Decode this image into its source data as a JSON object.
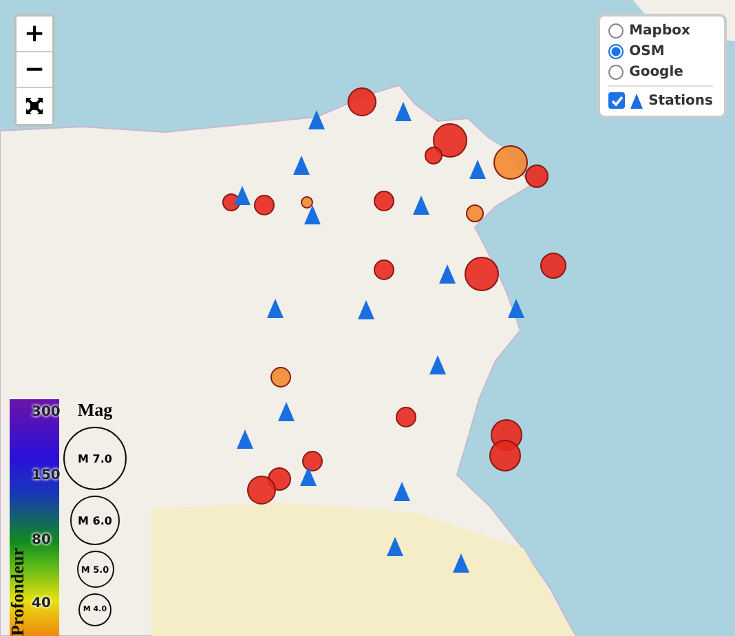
{
  "zoom_controls": [
    {
      "label": "+"
    },
    {
      "label": "−"
    }
  ],
  "layers": {
    "base_layers": [
      {
        "label": "Mapbox",
        "selected": false
      },
      {
        "label": "OSM",
        "selected": true
      },
      {
        "label": "Google",
        "selected": false
      }
    ],
    "overlays": [
      {
        "label": "Stations",
        "checked": true
      }
    ]
  },
  "legend": {
    "depth_title": "Profondeur",
    "depth_ticks": [
      "300",
      "150",
      "80",
      "40"
    ],
    "magnitude_title": "Mag",
    "magnitudes": [
      "M 7.0",
      "M 6.0",
      "M 5.0",
      "M 4.0"
    ]
  }
}
